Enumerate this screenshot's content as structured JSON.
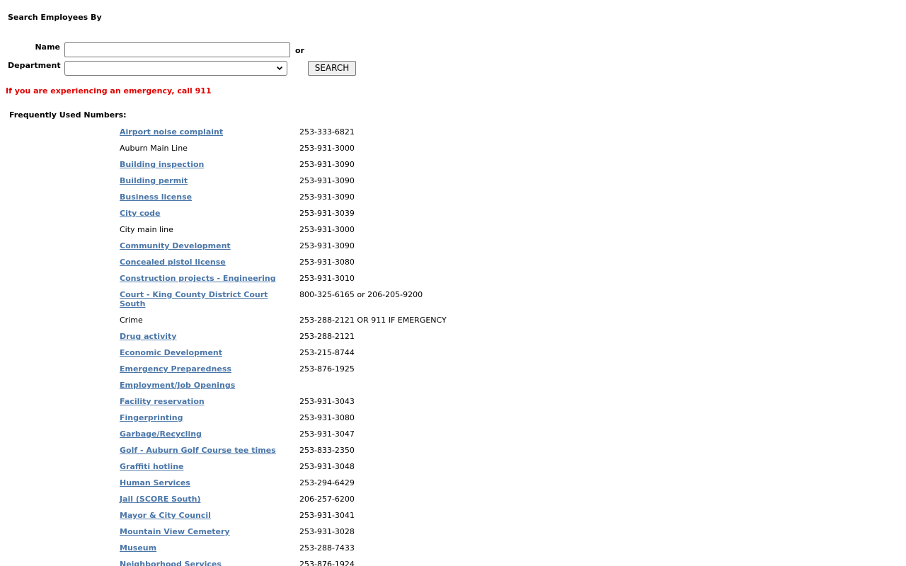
{
  "search": {
    "heading": "Search Employees By",
    "name_label": "Name",
    "name_value": "",
    "or_text": "or",
    "department_label": "Department",
    "department_selected": "",
    "button_label": "SEARCH"
  },
  "emergency_notice": "If you are experiencing an emergency, call 911",
  "frequent": {
    "heading": "Frequently Used Numbers:",
    "items": [
      {
        "label": "Airport noise complaint",
        "phone": "253-333-6821",
        "link": true
      },
      {
        "label": "Auburn Main Line",
        "phone": "253-931-3000",
        "link": false
      },
      {
        "label": "Building inspection",
        "phone": "253-931-3090",
        "link": true
      },
      {
        "label": "Building permit",
        "phone": "253-931-3090",
        "link": true
      },
      {
        "label": "Business license",
        "phone": "253-931-3090",
        "link": true
      },
      {
        "label": "City code",
        "phone": "253-931-3039",
        "link": true
      },
      {
        "label": "City main line",
        "phone": "253-931-3000",
        "link": false
      },
      {
        "label": "Community Development",
        "phone": "253-931-3090",
        "link": true
      },
      {
        "label": "Concealed pistol license",
        "phone": "253-931-3080",
        "link": true
      },
      {
        "label": "Construction projects - Engineering",
        "phone": "253-931-3010",
        "link": true
      },
      {
        "label": "Court - King County District Court South",
        "phone": "800-325-6165 or 206-205-9200",
        "link": true,
        "tall": true
      },
      {
        "label": "Crime",
        "phone": "253-288-2121 OR 911 IF EMERGENCY",
        "link": false
      },
      {
        "label": "Drug activity",
        "phone": "253-288-2121",
        "link": true
      },
      {
        "label": "Economic Development",
        "phone": "253-215-8744",
        "link": true
      },
      {
        "label": "Emergency Preparedness",
        "phone": "253-876-1925",
        "link": true
      },
      {
        "label": "Employment/Job Openings",
        "phone": "",
        "link": true
      },
      {
        "label": "Facility reservation",
        "phone": "253-931-3043",
        "link": true
      },
      {
        "label": "Fingerprinting",
        "phone": "253-931-3080",
        "link": true
      },
      {
        "label": "Garbage/Recycling",
        "phone": "253-931-3047",
        "link": true
      },
      {
        "label": "Golf - Auburn Golf Course tee times",
        "phone": "253-833-2350",
        "link": true
      },
      {
        "label": "Graffiti hotline",
        "phone": "253-931-3048",
        "link": true
      },
      {
        "label": "Human Services",
        "phone": "253-294-6429",
        "link": true
      },
      {
        "label": "Jail (SCORE South)",
        "phone": "206-257-6200",
        "link": true
      },
      {
        "label": "Mayor & City Council",
        "phone": "253-931-3041",
        "link": true
      },
      {
        "label": "Mountain View Cemetery",
        "phone": "253-931-3028",
        "link": true
      },
      {
        "label": "Museum",
        "phone": "253-288-7433",
        "link": true
      },
      {
        "label": "Neighborhood Services",
        "phone": "253-876-1924",
        "link": true
      }
    ]
  }
}
